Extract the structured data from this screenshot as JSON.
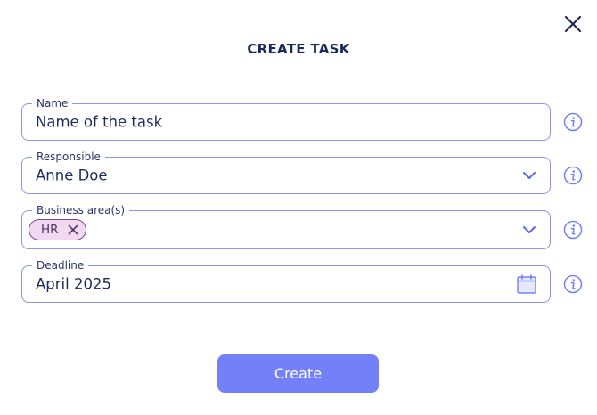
{
  "dialog": {
    "title": "CREATE TASK",
    "close_icon": "close-icon"
  },
  "fields": {
    "name": {
      "label": "Name",
      "value": "Name of the task"
    },
    "responsible": {
      "label": "Responsible",
      "value": "Anne Doe"
    },
    "business_area": {
      "label": "Business area(s)",
      "chips": [
        "HR"
      ]
    },
    "deadline": {
      "label": "Deadline",
      "value": "April 2025"
    }
  },
  "icons": {
    "info": "info-icon",
    "dropdown": "chevron-down-icon",
    "calendar": "calendar-icon",
    "chip_remove": "close-icon"
  },
  "actions": {
    "create_label": "Create"
  },
  "colors": {
    "accent": "#7480f8",
    "field_border": "#8a96f0",
    "title": "#1c2b5e",
    "chip_bg": "#f2d8f0",
    "chip_border": "#7a4c8c"
  }
}
